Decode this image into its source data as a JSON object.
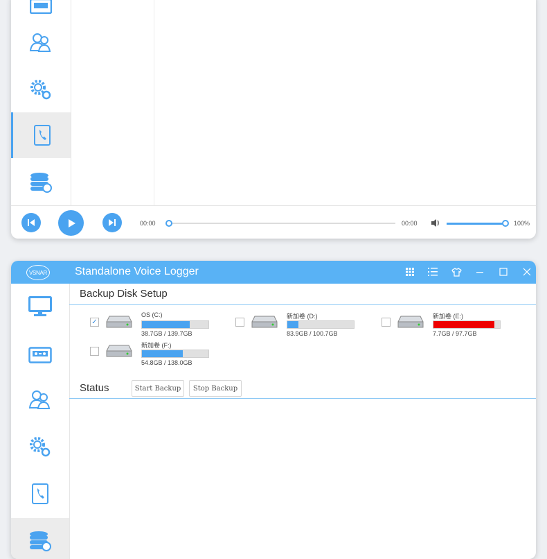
{
  "player": {
    "time_start": "00:00",
    "time_end": "00:00",
    "progress": 0,
    "volume_label": "100%",
    "volume": 1.0
  },
  "app": {
    "title": "Standalone Voice Logger",
    "logo_text": "VSNAR",
    "accent": "#59b2f5"
  },
  "backup": {
    "section_title": "Backup Disk Setup",
    "disks": [
      {
        "name": "OS (C:)",
        "size": "38.7GB / 139.7GB",
        "used_fraction": 0.72,
        "checked": true,
        "bar_color": "#4aa3f0"
      },
      {
        "name": "新加卷 (D:)",
        "size": "83.9GB / 100.7GB",
        "used_fraction": 0.17,
        "checked": false,
        "bar_color": "#4aa3f0"
      },
      {
        "name": "新加卷 (E:)",
        "size": "7.7GB / 97.7GB",
        "used_fraction": 0.92,
        "checked": false,
        "bar_color": "#ee0000"
      },
      {
        "name": "新加卷 (F:)",
        "size": "54.8GB / 138.0GB",
        "used_fraction": 0.61,
        "checked": false,
        "bar_color": "#4aa3f0"
      }
    ]
  },
  "status": {
    "title": "Status",
    "start_label": "Start Backup",
    "stop_label": "Stop Backup"
  }
}
